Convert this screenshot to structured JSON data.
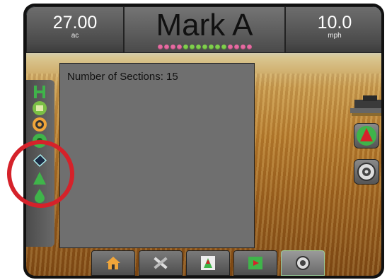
{
  "top_bar": {
    "left": {
      "value": "27.00",
      "unit": "ac"
    },
    "center": {
      "title": "Mark A"
    },
    "right": {
      "value": "10.0",
      "unit": "mph"
    }
  },
  "section_indicators": {
    "colors": [
      "#e76aa1",
      "#e76aa1",
      "#e76aa1",
      "#e76aa1",
      "#7fd14c",
      "#7fd14c",
      "#7fd14c",
      "#7fd14c",
      "#7fd14c",
      "#7fd14c",
      "#7fd14c",
      "#e76aa1",
      "#e76aa1",
      "#e76aa1",
      "#e76aa1"
    ]
  },
  "info_panel": {
    "sections_label": "Number of Sections: 15"
  },
  "left_sidebar": {
    "icons": [
      "implement-icon",
      "boom-section-icon",
      "guidance-status-icon",
      "gps-icon",
      "tilt-icon",
      "steering-icon",
      "product-drop-icon"
    ]
  },
  "right_buttons": [
    "perspective-view-icon",
    "zoom-icon"
  ],
  "bottom_nav": {
    "items": [
      "home-icon",
      "tools-icon",
      "vehicle-view-icon",
      "field-view-icon",
      "real-view-icon"
    ],
    "active": "real-view-icon"
  },
  "colors": {
    "highlight": "#d5222a",
    "accent_green": "#3fb44a"
  }
}
